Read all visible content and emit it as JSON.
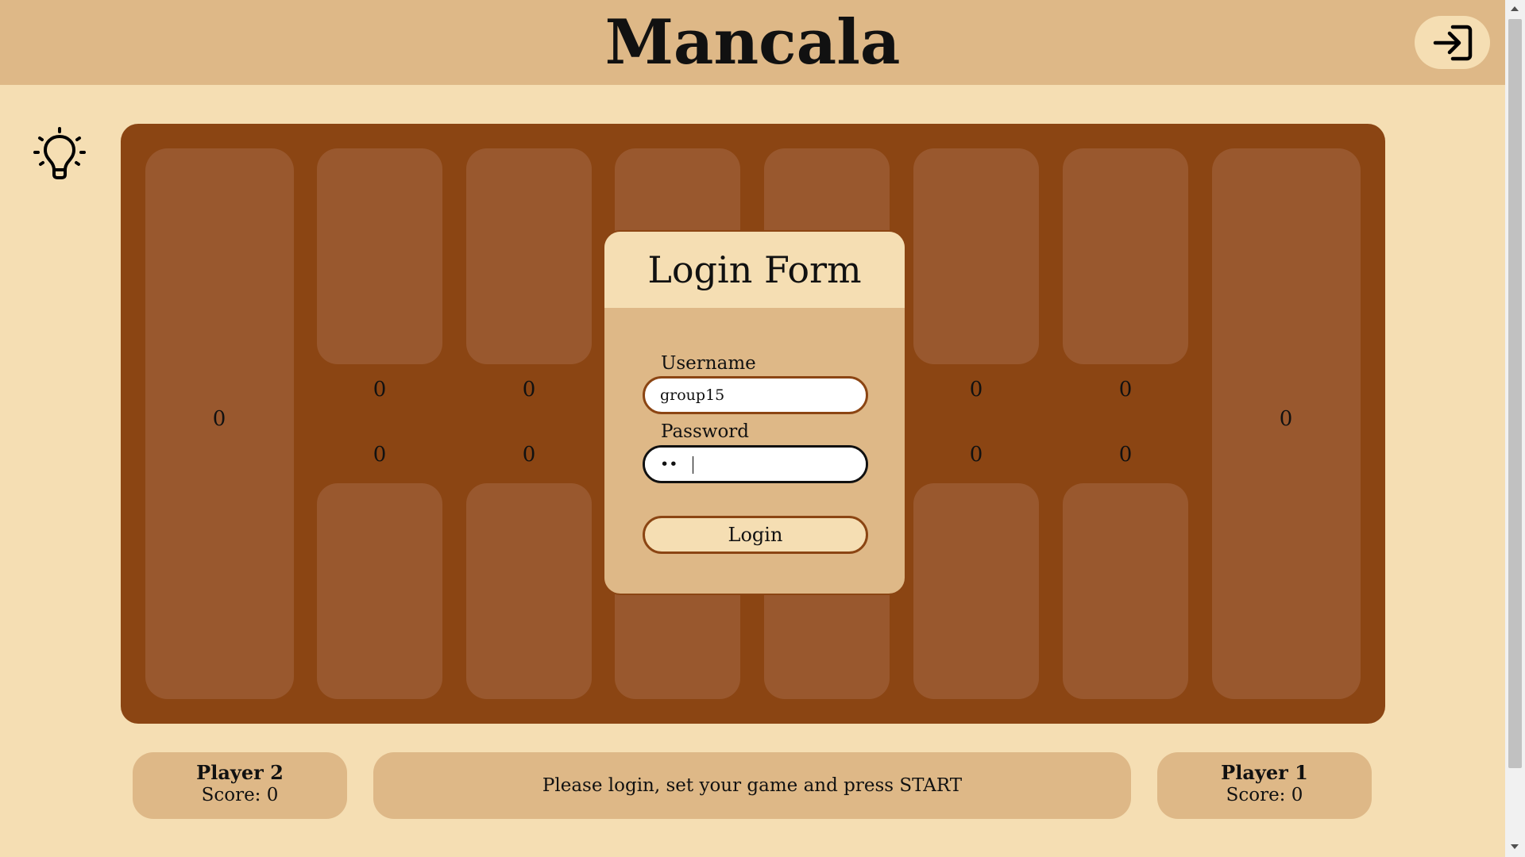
{
  "header": {
    "title": "Mancala"
  },
  "board": {
    "left_store": "0",
    "right_store": "0",
    "top_row": [
      "0",
      "0",
      "0",
      "0"
    ],
    "bottom_row": [
      "0",
      "0",
      "0",
      "0"
    ]
  },
  "login": {
    "title": "Login Form",
    "username_label": "Username",
    "username_value": "group15",
    "password_label": "Password",
    "password_value": "••",
    "button": "Login"
  },
  "footer": {
    "left_player": {
      "name": "Player 2",
      "score": "Score: 0"
    },
    "message": "Please login, set your game and press START",
    "right_player": {
      "name": "Player 1",
      "score": "Score: 0"
    }
  },
  "icons": {
    "login": "login-arrow-icon",
    "hint": "lightbulb-icon"
  },
  "colors": {
    "board": "#8b4513",
    "pit": "#99582e",
    "panel": "#deb887",
    "background": "#f5deb3"
  }
}
